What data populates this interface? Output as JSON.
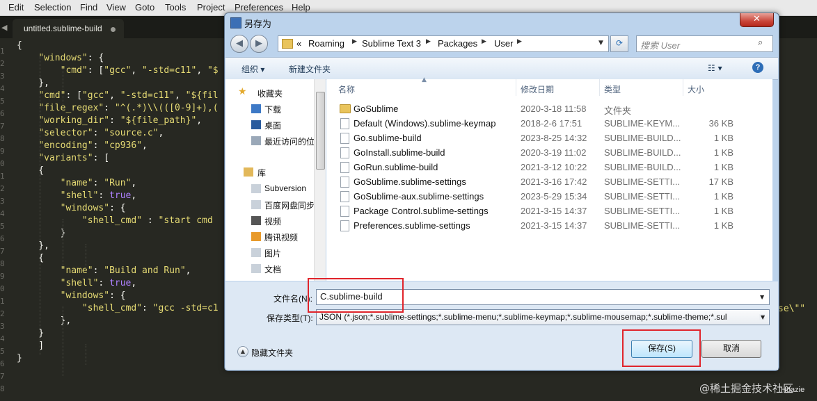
{
  "menu": [
    "Edit",
    "Selection",
    "Find",
    "View",
    "Goto",
    "Tools",
    "Project",
    "Preferences",
    "Help"
  ],
  "tab": {
    "title": "untitled.sublime-build"
  },
  "line_numbers": [
    "1",
    "2",
    "3",
    "4",
    "5",
    "6",
    "7",
    "8",
    "9",
    "0",
    "1",
    "2",
    "3",
    "4",
    "5",
    "6",
    "7",
    "8",
    "9",
    "0",
    "1",
    "2",
    "3",
    "4",
    "5",
    "6",
    "7",
    "8"
  ],
  "code_lines": [
    "{",
    "    \"windows\": {",
    "        \"cmd\": [\"gcc\", \"-std=c11\", \"$",
    "    },",
    "    \"cmd\": [\"gcc\", \"-std=c11\", \"${fil",
    "    \"file_regex\": \"^(.*)\\\\(([0-9]+),(",
    "    \"working_dir\": \"${file_path}\",",
    "    \"selector\": \"source.c\",",
    "    \"encoding\": \"cp936\",",
    "    \"variants\": [",
    "    {",
    "        \"name\": \"Run\",",
    "        \"shell\": true,",
    "        \"windows\": {",
    "            \"shell_cmd\" : \"start cmd",
    "        }",
    "    },",
    "    {",
    "        \"name\": \"Build and Run\",",
    "        \"shell\": true,",
    "        \"windows\": {",
    "            \"shell_cmd\": \"gcc -std=c1",
    "        },",
    "    }",
    "    ]",
    "}"
  ],
  "code_right": "se\\\"\"",
  "dialog": {
    "title": "另存为",
    "close": "✕",
    "breadcrumb": [
      "Roaming",
      "Sublime Text 3",
      "Packages",
      "User"
    ],
    "breadcrumb_prefix": "«",
    "search_placeholder": "搜索 User",
    "toolbar": {
      "organize": "组织 ▾",
      "new_folder": "新建文件夹",
      "help": "?"
    },
    "nav": {
      "favorites": "收藏夹",
      "downloads": "下载",
      "desktop": "桌面",
      "recent": "最近访问的位",
      "libraries": "库",
      "subversion": "Subversion",
      "baidu": "百度网盘同步",
      "video": "视频",
      "tencent_video": "腾讯视频",
      "pictures": "图片",
      "documents": "文档"
    },
    "columns": {
      "name": "名称",
      "date": "修改日期",
      "type": "类型",
      "size": "大小"
    },
    "files": [
      {
        "name": "GoSublime",
        "date": "2020-3-18 11:58",
        "type": "文件夹",
        "size": "",
        "folder": true
      },
      {
        "name": "Default (Windows).sublime-keymap",
        "date": "2018-2-6 17:51",
        "type": "SUBLIME-KEYM...",
        "size": "36 KB"
      },
      {
        "name": "Go.sublime-build",
        "date": "2023-8-25 14:32",
        "type": "SUBLIME-BUILD...",
        "size": "1 KB"
      },
      {
        "name": "GoInstall.sublime-build",
        "date": "2020-3-19 11:02",
        "type": "SUBLIME-BUILD...",
        "size": "1 KB"
      },
      {
        "name": "GoRun.sublime-build",
        "date": "2021-3-12 10:22",
        "type": "SUBLIME-BUILD...",
        "size": "1 KB"
      },
      {
        "name": "GoSublime.sublime-settings",
        "date": "2021-3-16 17:42",
        "type": "SUBLIME-SETTI...",
        "size": "17 KB"
      },
      {
        "name": "GoSublime-aux.sublime-settings",
        "date": "2023-5-29 15:34",
        "type": "SUBLIME-SETTI...",
        "size": "1 KB"
      },
      {
        "name": "Package Control.sublime-settings",
        "date": "2021-3-15 14:37",
        "type": "SUBLIME-SETTI...",
        "size": "1 KB"
      },
      {
        "name": "Preferences.sublime-settings",
        "date": "2021-3-15 14:37",
        "type": "SUBLIME-SETTI...",
        "size": "1 KB"
      }
    ],
    "filename_label": "文件名(N):",
    "filename_value": "C.sublime-build",
    "filetype_label": "保存类型(T):",
    "filetype_value": "JSON (*.json;*.sublime-settings;*.sublime-menu;*.sublime-keymap;*.sublime-mousemap;*.sublime-theme;*.sul",
    "hide_folders": "隐藏文件夹",
    "save": "保存(S)",
    "cancel": "取消"
  },
  "watermark": "@稀土掘金技术社区",
  "watermark2": "Huazie",
  "colors": {
    "highlight": "#e0242b",
    "editor_bg": "#272822",
    "string": "#e6db74",
    "constant": "#ae81ff"
  }
}
